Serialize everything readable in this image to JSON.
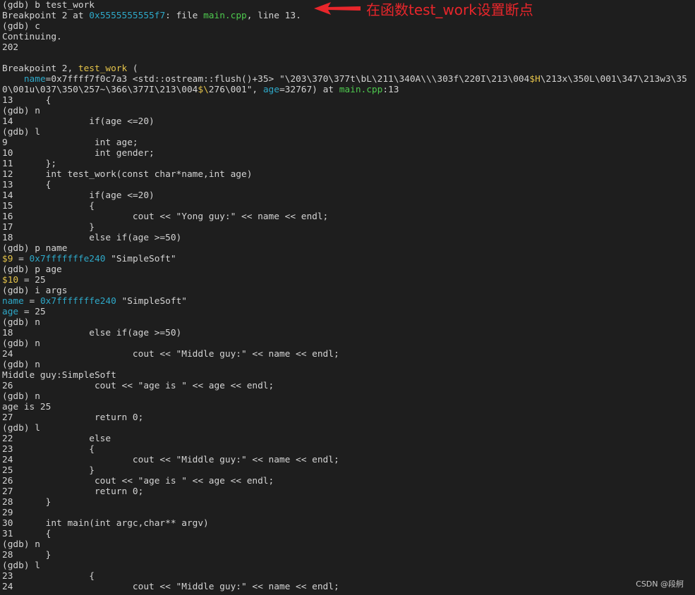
{
  "annotation": {
    "text": "在函数test_work设置断点",
    "color": "#e8262b"
  },
  "watermark": "CSDN @段舸",
  "colors": {
    "background": "#1e1e1e",
    "text": "#d4d4d4",
    "green": "#4ec94e",
    "cyan": "#2ea8c8",
    "yellow": "#e5c44a"
  },
  "lines": [
    [
      {
        "t": "(gdb) b test_work"
      }
    ],
    [
      {
        "t": "Breakpoint 2 at "
      },
      {
        "t": "0x5555555555f7",
        "c": "cyan"
      },
      {
        "t": ": file "
      },
      {
        "t": "main.cpp",
        "c": "green"
      },
      {
        "t": ", line 13."
      }
    ],
    [
      {
        "t": "(gdb) c"
      }
    ],
    [
      {
        "t": "Continuing."
      }
    ],
    [
      {
        "t": "202"
      }
    ],
    [
      {
        "t": ""
      }
    ],
    [
      {
        "t": "Breakpoint 2, "
      },
      {
        "t": "test_work",
        "c": "yellow"
      },
      {
        "t": " ("
      }
    ],
    [
      {
        "t": "    "
      },
      {
        "t": "name",
        "c": "cyan"
      },
      {
        "t": "=0x7ffff7f0c7a3 <std::ostream::flush()+35> \"\\203\\370\\377t\\bL\\211\\340A\\\\\\303f\\220I\\213\\004"
      },
      {
        "t": "$H",
        "c": "yellow"
      },
      {
        "t": "\\213x\\350L\\001\\347\\213w3\\350\\001u\\037\\350\\257~\\366\\377I\\213\\004"
      },
      {
        "t": "$\\",
        "c": "yellow"
      },
      {
        "t": "276\\001\", "
      },
      {
        "t": "age",
        "c": "cyan"
      },
      {
        "t": "=32767) at "
      },
      {
        "t": "main.cpp",
        "c": "green"
      },
      {
        "t": ":13"
      }
    ],
    [
      {
        "t": "13      {"
      }
    ],
    [
      {
        "t": "(gdb) n"
      }
    ],
    [
      {
        "t": "14              if(age <=20)"
      }
    ],
    [
      {
        "t": "(gdb) l"
      }
    ],
    [
      {
        "t": "9                int age;"
      }
    ],
    [
      {
        "t": "10               int gender;"
      }
    ],
    [
      {
        "t": "11      };"
      }
    ],
    [
      {
        "t": "12      int test_work(const char*name,int age)"
      }
    ],
    [
      {
        "t": "13      {"
      }
    ],
    [
      {
        "t": "14              if(age <=20)"
      }
    ],
    [
      {
        "t": "15              {"
      }
    ],
    [
      {
        "t": "16                      cout << \"Yong guy:\" << name << endl;"
      }
    ],
    [
      {
        "t": "17              }"
      }
    ],
    [
      {
        "t": "18              else if(age >=50)"
      }
    ],
    [
      {
        "t": "(gdb) p name"
      }
    ],
    [
      {
        "t": "$9",
        "c": "yellow"
      },
      {
        "t": " = "
      },
      {
        "t": "0x7fffffffe240",
        "c": "cyan"
      },
      {
        "t": " \"SimpleSoft\""
      }
    ],
    [
      {
        "t": "(gdb) p age"
      }
    ],
    [
      {
        "t": "$10",
        "c": "yellow"
      },
      {
        "t": " = 25"
      }
    ],
    [
      {
        "t": "(gdb) i args"
      }
    ],
    [
      {
        "t": "name",
        "c": "cyan"
      },
      {
        "t": " = "
      },
      {
        "t": "0x7fffffffe240",
        "c": "cyan"
      },
      {
        "t": " \"SimpleSoft\""
      }
    ],
    [
      {
        "t": "age",
        "c": "cyan"
      },
      {
        "t": " = 25"
      }
    ],
    [
      {
        "t": "(gdb) n"
      }
    ],
    [
      {
        "t": "18              else if(age >=50)"
      }
    ],
    [
      {
        "t": "(gdb) n"
      }
    ],
    [
      {
        "t": "24                      cout << \"Middle guy:\" << name << endl;"
      }
    ],
    [
      {
        "t": "(gdb) n"
      }
    ],
    [
      {
        "t": "Middle guy:SimpleSoft"
      }
    ],
    [
      {
        "t": "26               cout << \"age is \" << age << endl;"
      }
    ],
    [
      {
        "t": "(gdb) n"
      }
    ],
    [
      {
        "t": "age is 25"
      }
    ],
    [
      {
        "t": "27               return 0;"
      }
    ],
    [
      {
        "t": "(gdb) l"
      }
    ],
    [
      {
        "t": "22              else"
      }
    ],
    [
      {
        "t": "23              {"
      }
    ],
    [
      {
        "t": "24                      cout << \"Middle guy:\" << name << endl;"
      }
    ],
    [
      {
        "t": "25              }"
      }
    ],
    [
      {
        "t": "26               cout << \"age is \" << age << endl;"
      }
    ],
    [
      {
        "t": "27               return 0;"
      }
    ],
    [
      {
        "t": "28      }"
      }
    ],
    [
      {
        "t": "29"
      }
    ],
    [
      {
        "t": "30      int main(int argc,char** argv)"
      }
    ],
    [
      {
        "t": "31      {"
      }
    ],
    [
      {
        "t": "(gdb) n"
      }
    ],
    [
      {
        "t": "28      }"
      }
    ],
    [
      {
        "t": "(gdb) l"
      }
    ],
    [
      {
        "t": "23              {"
      }
    ],
    [
      {
        "t": "24                      cout << \"Middle guy:\" << name << endl;"
      }
    ]
  ]
}
